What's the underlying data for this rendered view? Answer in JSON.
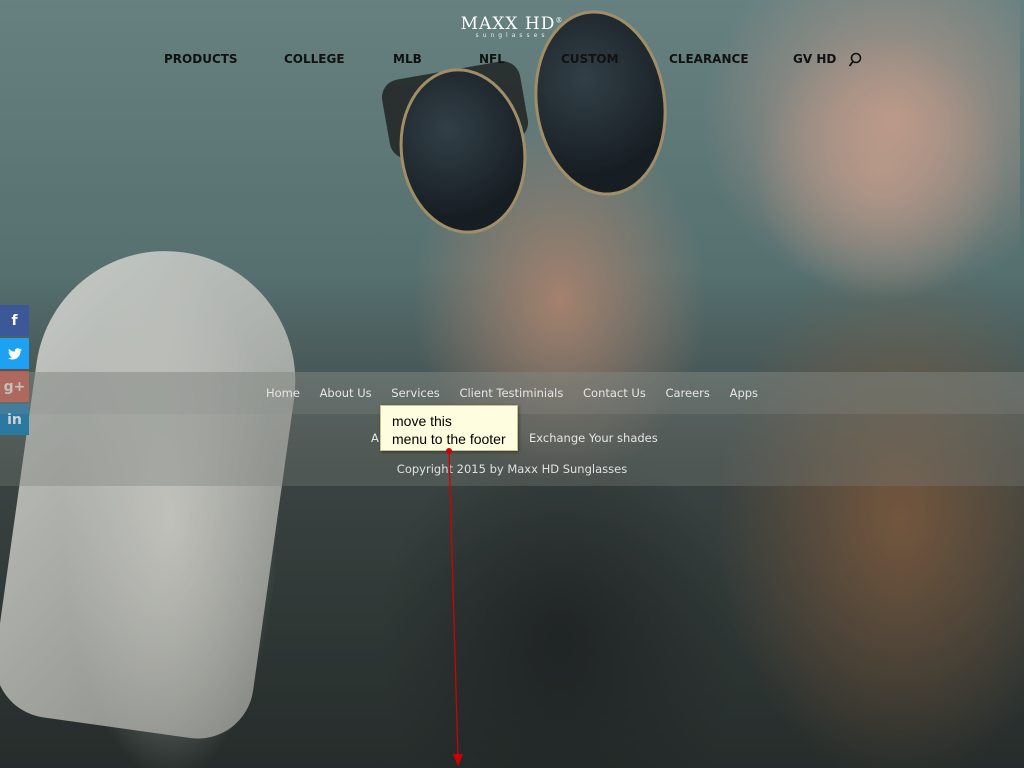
{
  "header": {
    "logo_main": "MAXX HD",
    "logo_reg": "®",
    "logo_sub": "sunglasses"
  },
  "nav": {
    "items": [
      {
        "label": "PRODUCTS"
      },
      {
        "label": "COLLEGE"
      },
      {
        "label": "MLB"
      },
      {
        "label": "NFL"
      },
      {
        "label": "CUSTOM"
      },
      {
        "label": "CLEARANCE"
      },
      {
        "label": "GV HD"
      }
    ],
    "search_icon": "search-icon"
  },
  "social": {
    "facebook": "f",
    "twitter": "t",
    "googleplus": "g+",
    "linkedin": "in"
  },
  "footer": {
    "menu": [
      "Home",
      "About Us",
      "Services",
      "Client Testiminials",
      "Contact Us",
      "Careers",
      "Apps"
    ],
    "row2_partial": "A",
    "row2_exchange": "Exchange Your shades",
    "copyright": "Copyright 2015 by Maxx HD Sunglasses"
  },
  "annotation": {
    "line1": "move this",
    "line2": "menu to the footer"
  },
  "colors": {
    "facebook": "#3b5998",
    "twitter": "#1da1f2",
    "googleplus": "#dd4b39",
    "linkedin": "#0077b5",
    "annotation_arrow": "#d10000"
  }
}
